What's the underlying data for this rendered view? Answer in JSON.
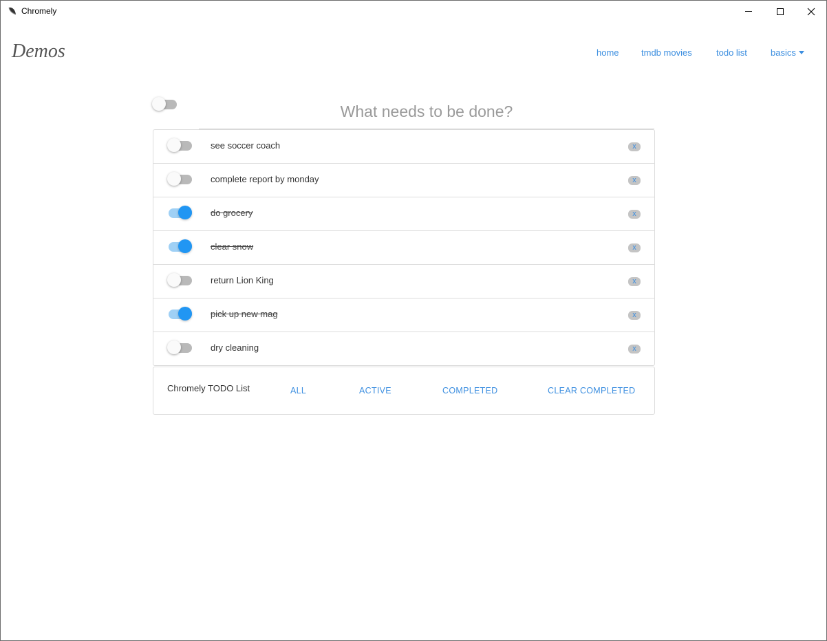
{
  "window": {
    "title": "Chromely",
    "close_glyph": "✕"
  },
  "nav": {
    "brand": "Demos",
    "links": [
      {
        "label": "home"
      },
      {
        "label": "tmdb movies"
      },
      {
        "label": "todo list"
      },
      {
        "label": "basics"
      }
    ]
  },
  "todo": {
    "toggle_all_checked": false,
    "input_placeholder": "What needs to be done?",
    "input_value": "",
    "delete_label": "x",
    "items": [
      {
        "text": "see soccer coach",
        "completed": false
      },
      {
        "text": "complete report by monday",
        "completed": false
      },
      {
        "text": "do grocery",
        "completed": true
      },
      {
        "text": "clear snow",
        "completed": true
      },
      {
        "text": "return Lion King",
        "completed": false
      },
      {
        "text": "pick up new mag",
        "completed": true
      },
      {
        "text": "dry cleaning",
        "completed": false
      }
    ],
    "footer": {
      "title": "Chromely TODO List",
      "filters": [
        {
          "label": "ALL"
        },
        {
          "label": "ACTIVE"
        },
        {
          "label": "COMPLETED"
        },
        {
          "label": "CLEAR COMPLETED"
        }
      ]
    }
  },
  "colors": {
    "accent": "#2196f3",
    "link": "#3d8fe0"
  }
}
